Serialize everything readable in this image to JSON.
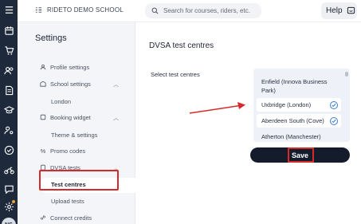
{
  "rail": {
    "icons": [
      "hamburger-menu-icon",
      "calendar-icon",
      "cart-icon",
      "users-icon",
      "document-icon",
      "lesson-icon",
      "graduation-icon",
      "user-key-icon",
      "check-circle-icon",
      "motorcycle-icon",
      "chat-icon",
      "settings-icon"
    ],
    "avatar_initials": "NS"
  },
  "header": {
    "school_name": "RIDETO DEMO SCHOOL",
    "search_placeholder": "Search for courses, riders, etc.",
    "help_label": "Help"
  },
  "sidebar": {
    "title": "Settings",
    "profile_settings": "Profile settings",
    "school_settings": "School settings",
    "london": "London",
    "booking_widget": "Booking widget",
    "theme_settings": "Theme & settings",
    "promo_codes": "Promo codes",
    "dvsa_tests": "DVSA tests",
    "test_centres": "Test centres",
    "upload_tests": "Upload tests",
    "connect_credits": "Connect credits"
  },
  "main": {
    "title": "DVSA test centres",
    "select_label": "Select test centres",
    "centres": [
      {
        "name": "Enfield (Innova Business Park)",
        "selected": false
      },
      {
        "name": "Uxbridge (London)",
        "selected": true
      },
      {
        "name": "Aberdeen South (Cove)",
        "selected": true
      },
      {
        "name": "Atherton (Manchester)",
        "selected": false
      }
    ],
    "save_label": "Save"
  },
  "colors": {
    "rail_bg": "#1e2a3c",
    "sidebar_bg": "#f3f5f8",
    "save_bg": "#141c2c",
    "annotation_red": "#d62a2a",
    "check_blue": "#3a7bd5"
  }
}
